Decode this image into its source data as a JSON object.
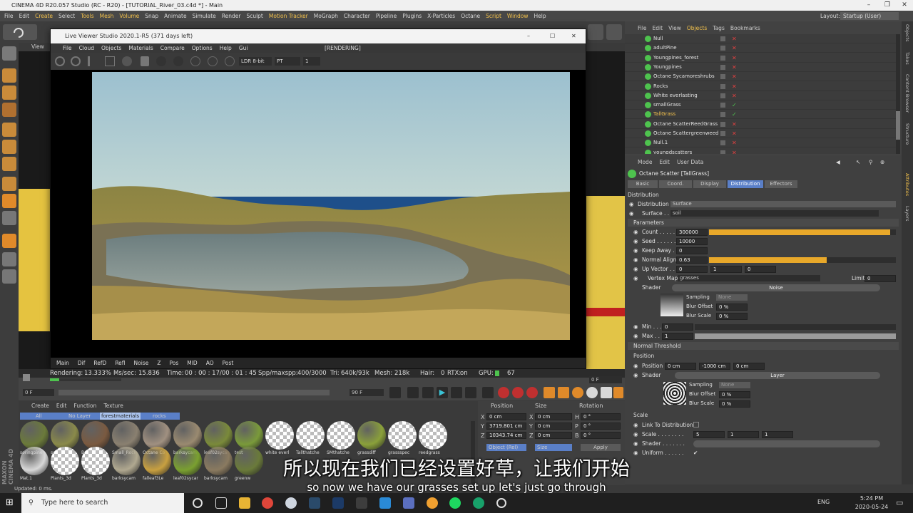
{
  "window": {
    "title": "CINEMA 4D R20.057 Studio (RC - R20) - [TUTORIAL_River_03.c4d *] - Main"
  },
  "menubar": [
    "File",
    "Edit",
    "Create",
    "Select",
    "Tools",
    "Mesh",
    "Volume",
    "Snap",
    "Animate",
    "Simulate",
    "Render",
    "Sculpt",
    "Motion Tracker",
    "MoGraph",
    "Character",
    "Pipeline",
    "Plugins",
    "X-Particles",
    "Octane",
    "Script",
    "Window",
    "Help"
  ],
  "layout": {
    "label": "Layout:",
    "value": "Startup (User)"
  },
  "viewport": {
    "label": "View"
  },
  "live_viewer": {
    "title": "Live Viewer Studio 2020.1-R5 (371 days left)",
    "menu": [
      "File",
      "Cloud",
      "Objects",
      "Materials",
      "Compare",
      "Options",
      "Help",
      "Gui"
    ],
    "state": "[RENDERING]",
    "ldr_select": "LDR 8-bit",
    "pt_select": "PT",
    "pass_num": "1",
    "tabs": [
      "Main",
      "Dif",
      "RefD",
      "Refl",
      "Noise",
      "Z",
      "Pos",
      "MID",
      "AO",
      "Post"
    ]
  },
  "render_status": {
    "rendering_label": "Rendering:",
    "rendering": "13.333%",
    "mssec_label": "Ms/sec:",
    "mssec": "15.836",
    "time_label": "Time:",
    "time": "00 : 00 : 17/00 : 01 : 45",
    "spp_label": "Spp/maxspp:",
    "spp": "400/3000",
    "tri_label": "Tri:",
    "tri": "640k/93k",
    "mesh_label": "Mesh:",
    "mesh": "218k",
    "hair_label": "Hair:",
    "hair": "0",
    "rtx_label": "RTX:",
    "rtx": "on",
    "gpu_label": "GPU:",
    "gpu": "67",
    "progress": 0.133
  },
  "timeline": {
    "start": "0 F",
    "end": "90 F",
    "current": "0 F",
    "marker": "0"
  },
  "materials": {
    "menu": [
      "Create",
      "Edit",
      "Function",
      "Texture"
    ],
    "filters": [
      "All",
      "No Layer",
      "forestmaterials",
      "rocks"
    ],
    "row1": [
      "soringpine",
      "summerpin",
      "Bark",
      "Small_Rock",
      "Octane Co",
      "barksycam",
      "leaf02sycar",
      "test",
      "white everl",
      "Tallthatche",
      "SMthatche",
      "grassdiff",
      "grassspec",
      "reedgrass"
    ],
    "row2": [
      "Mat.1",
      "Plants_3d",
      "Plants_3d",
      "barksycam",
      "falleaf3Le",
      "leaf02sycar",
      "barksycam",
      "greenw"
    ]
  },
  "coords": {
    "headers": [
      "Position",
      "Size",
      "Rotation"
    ],
    "rows": [
      {
        "axis": "X",
        "pos": "0 cm",
        "saxis": "X",
        "size": "0 cm",
        "raxis": "H",
        "rot": "0 °"
      },
      {
        "axis": "Y",
        "pos": "3719.801 cm",
        "saxis": "Y",
        "size": "0 cm",
        "raxis": "P",
        "rot": "0 °"
      },
      {
        "axis": "Z",
        "pos": "10343.74 cm",
        "saxis": "Z",
        "size": "0 cm",
        "raxis": "B",
        "rot": "0 °"
      }
    ],
    "mode": "Object (Rel)",
    "size_mode": "Size",
    "apply": "Apply"
  },
  "objects": {
    "menu": [
      "File",
      "Edit",
      "View",
      "Objects",
      "Tags",
      "Bookmarks"
    ],
    "items": [
      {
        "name": "Null",
        "selected": false
      },
      {
        "name": "adultPine",
        "selected": false
      },
      {
        "name": "Youngpines_forest",
        "selected": false
      },
      {
        "name": "Youngpines",
        "selected": false
      },
      {
        "name": "Octane Sycamoreshrubs",
        "selected": false
      },
      {
        "name": "Rocks",
        "selected": false
      },
      {
        "name": "White everlasting",
        "selected": false
      },
      {
        "name": "smallGrass",
        "selected": false
      },
      {
        "name": "TallGrass",
        "selected": true
      },
      {
        "name": "Octane ScatterReedGrass",
        "selected": false
      },
      {
        "name": "Octane Scattergreenweed",
        "selected": false
      },
      {
        "name": "Null.1",
        "selected": false
      },
      {
        "name": "youngdscatters",
        "selected": false
      }
    ]
  },
  "attributes": {
    "menu": [
      "Mode",
      "Edit",
      "User Data"
    ],
    "object_title": "Octane Scatter [TallGrass]",
    "tabs": [
      "Basic",
      "Coord.",
      "Display",
      "Distribution",
      "Effectors"
    ],
    "active_tab": "Distribution",
    "section_distribution": "Distribution",
    "distribution_label": "Distribution",
    "distribution_value": "Surface",
    "surface_label": "Surface . .",
    "surface_value": "soil",
    "parameters": "Parameters",
    "count_label": "Count . . . . . .",
    "count": "300000",
    "count_level": 0.97,
    "seed_label": "Seed . . . . . . .",
    "seed": "10000",
    "keepaway_label": "Keep Away . .",
    "keepaway": "0",
    "normalalign_label": "Normal Align",
    "normalalign": "0.63",
    "normalalign_level": 0.63,
    "upvector_label": "Up Vector . . .",
    "upvector": [
      "0",
      "1",
      "0"
    ],
    "vertexmap_label": "Vertex Map",
    "vertexmap": "grasses",
    "limit_label": "Limit",
    "limit": "0",
    "shader_label": "Shader",
    "shader_name": "Noise",
    "sampling_label": "Sampling",
    "sampling": "None",
    "bluroffset_label": "Blur Offset",
    "bluroffset": "0 %",
    "blurscale_label": "Blur Scale",
    "blurscale": "0 %",
    "min_label": "Min . . .",
    "min": "0",
    "max_label": "Max . . .",
    "max": "1",
    "normal_threshold": "Normal Threshold",
    "section_position": "Position",
    "position_label": "Position",
    "position": [
      "0 cm",
      "-1000 cm",
      "0 cm"
    ],
    "pos_shader_label": "Shader",
    "pos_shader_name": "Layer",
    "pos_sampling": "None",
    "pos_bluroffset": "0 %",
    "pos_blurscale": "0 %",
    "section_scale": "Scale",
    "link_label": "Link To Distribution",
    "scale_label": "Scale . . . . . . . .",
    "scale": [
      "5",
      "1",
      "1"
    ],
    "scale_shader_label": "Shader . . . . . . .",
    "uniform_label": "Uniform . . . . . ."
  },
  "right_tabs": [
    "Objects",
    "Takes",
    "Content Browser",
    "Structure",
    "Attributes",
    "Layers"
  ],
  "app_status": "Updated: 0 ms.",
  "brand": "MAXON CINEMA 4D",
  "subtitles": {
    "cn": "所以现在我们已经设置好草，让我们开始",
    "en": "so now we have our grasses set up let's just go through"
  },
  "taskbar": {
    "search_placeholder": "Type here to search",
    "time": "5:24 PM",
    "date": "2020-05-24",
    "lang": "ENG"
  },
  "colors": {
    "accent": "#f2c14c",
    "selected_tab": "#5a7fc7",
    "progress": "#4ec34e"
  }
}
